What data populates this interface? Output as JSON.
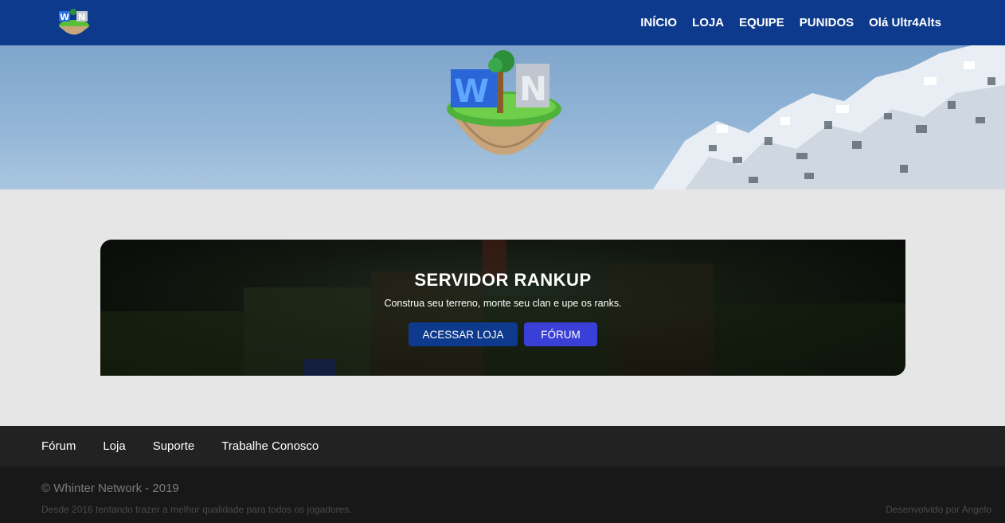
{
  "header": {
    "logo_icon": "whinter-island-logo-icon",
    "nav": [
      {
        "label": "INÍCIO"
      },
      {
        "label": "LOJA"
      },
      {
        "label": "EQUIPE"
      },
      {
        "label": "PUNIDOS"
      },
      {
        "label": "Olá Ultr4Alts"
      }
    ]
  },
  "hero": {
    "logo_icon": "whinter-island-big-logo-icon"
  },
  "banner": {
    "title": "SERVIDOR RANKUP",
    "subtitle": "Construa seu terreno, monte seu clan e upe os ranks.",
    "button_store": "ACESSAR LOJA",
    "button_forum": "FÓRUM"
  },
  "footer": {
    "links": [
      {
        "label": "Fórum"
      },
      {
        "label": "Loja"
      },
      {
        "label": "Suporte"
      },
      {
        "label": "Trabalhe Conosco"
      }
    ],
    "copyright": "© Whinter Network - 2019",
    "tagline": "Desde 2016 tentando trazer a melhor qualidade para todos os jogadores.",
    "developer": "Desenvolvido por Angelo"
  },
  "colors": {
    "topbar": "#0d3a8c",
    "button_store": "#0d3a8c",
    "button_forum": "#3a3fd8",
    "page_bg": "#e6e6e6",
    "footer_nav_bg": "#222222",
    "footer_bottom_bg": "#181818"
  }
}
